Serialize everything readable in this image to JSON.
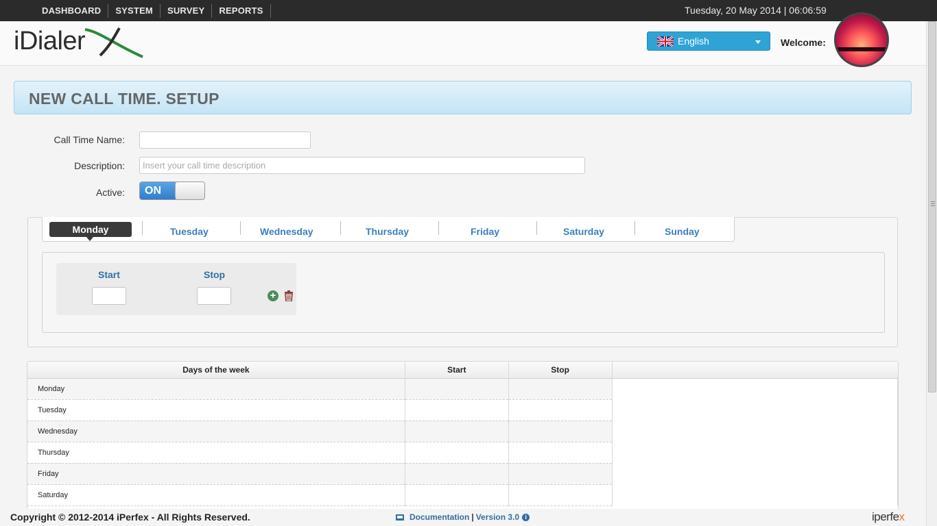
{
  "topnav": {
    "items": [
      "DASHBOARD",
      "SYSTEM",
      "SURVEY",
      "REPORTS"
    ],
    "datetime": "Tuesday, 20 May 2014 | 06:06:59"
  },
  "header": {
    "logo_text": "iDialer",
    "logo_mark": "X",
    "language": "English",
    "welcome_label": "Welcome:"
  },
  "page": {
    "title": "NEW CALL TIME. SETUP"
  },
  "form": {
    "name_label": "Call Time Name:",
    "name_value": "",
    "description_label": "Description:",
    "description_placeholder": "Insert your call time description",
    "active_label": "Active:",
    "active_state": "ON"
  },
  "tabs": {
    "active": "Monday",
    "items": [
      "Tuesday",
      "Wednesday",
      "Thursday",
      "Friday",
      "Saturday",
      "Sunday"
    ]
  },
  "time_range": {
    "start_label": "Start",
    "stop_label": "Stop"
  },
  "table": {
    "headers": [
      "Days of the week",
      "Start",
      "Stop"
    ],
    "rows": [
      "Monday",
      "Tuesday",
      "Wednesday",
      "Thursday",
      "Friday",
      "Saturday"
    ]
  },
  "footer": {
    "copyright": "Copyright © 2012-2014 iPerfex - All Rights Reserved.",
    "documentation": "Documentation",
    "separator": "|",
    "version": "Version 3.0",
    "brand_main": "iperfe",
    "brand_accent": "x"
  },
  "colors": {
    "accent": "#2fa3d6",
    "link": "#3a7fbf",
    "topbar": "#2b2b2b"
  }
}
